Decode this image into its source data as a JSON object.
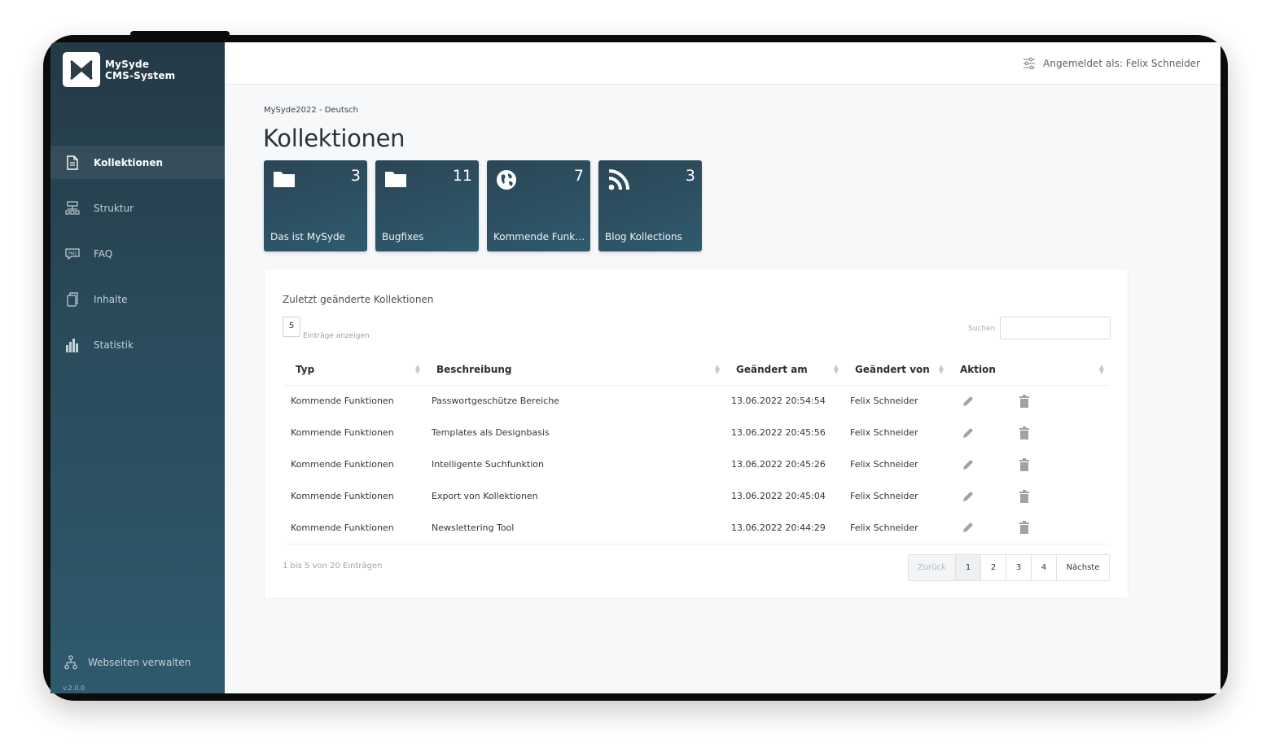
{
  "brand": {
    "line1": "MySyde",
    "line2": "CMS-System",
    "version": "v.2.0.0"
  },
  "sidebar": {
    "items": [
      {
        "label": "Kollektionen",
        "icon": "document-icon",
        "active": true
      },
      {
        "label": "Struktur",
        "icon": "sitemap-icon",
        "active": false
      },
      {
        "label": "FAQ",
        "icon": "faq-icon",
        "active": false
      },
      {
        "label": "Inhalte",
        "icon": "copy-icon",
        "active": false
      },
      {
        "label": "Statistik",
        "icon": "bar-chart-icon",
        "active": false
      }
    ],
    "bottom_label": "Webseiten verwalten"
  },
  "header": {
    "user_label": "Angemeldet als: Felix Schneider"
  },
  "breadcrumb": "MySyde2022 - Deutsch",
  "page_title": "Kollektionen",
  "tiles": [
    {
      "label": "Das ist MySyde",
      "count": "3",
      "icon": "folder-icon"
    },
    {
      "label": "Bugfixes",
      "count": "11",
      "icon": "folder-icon"
    },
    {
      "label": "Kommende Funktionen",
      "count": "7",
      "icon": "globe-icon"
    },
    {
      "label": "Blog Kollections",
      "count": "3",
      "icon": "rss-icon"
    }
  ],
  "recent": {
    "title": "Zuletzt geänderte Kollektionen",
    "entries_value": "5",
    "entries_label": "Einträge anzeigen",
    "search_label": "Suchen",
    "columns": [
      "Typ",
      "Beschreibung",
      "Geändert am",
      "Geändert von",
      "Aktion"
    ],
    "rows": [
      {
        "typ": "Kommende Funktionen",
        "beschreibung": "Passwortgeschütze Bereiche",
        "geaendert_am": "13.06.2022 20:54:54",
        "geaendert_von": "Felix Schneider"
      },
      {
        "typ": "Kommende Funktionen",
        "beschreibung": "Templates als Designbasis",
        "geaendert_am": "13.06.2022 20:45:56",
        "geaendert_von": "Felix Schneider"
      },
      {
        "typ": "Kommende Funktionen",
        "beschreibung": "Intelligente Suchfunktion",
        "geaendert_am": "13.06.2022 20:45:26",
        "geaendert_von": "Felix Schneider"
      },
      {
        "typ": "Kommende Funktionen",
        "beschreibung": "Export von Kollektionen",
        "geaendert_am": "13.06.2022 20:45:04",
        "geaendert_von": "Felix Schneider"
      },
      {
        "typ": "Kommende Funktionen",
        "beschreibung": "Newslettering Tool",
        "geaendert_am": "13.06.2022 20:44:29",
        "geaendert_von": "Felix Schneider"
      }
    ],
    "info": "1 bis 5 von 20 Einträgen",
    "pager": {
      "prev": "Zurück",
      "pages": [
        "1",
        "2",
        "3",
        "4"
      ],
      "next": "Nächste",
      "active": "1"
    }
  }
}
